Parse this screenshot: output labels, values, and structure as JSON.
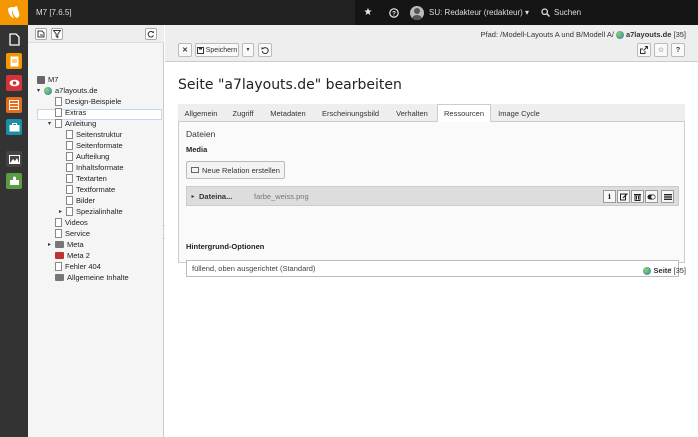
{
  "topbar": {
    "site_name": "M7 [7.6.5]",
    "user_label": "SU: Redakteur (redakteur) ▾",
    "search_label": "Suchen"
  },
  "modules": [
    {
      "name": "page-module",
      "color": "#3a3a3a"
    },
    {
      "name": "list-module",
      "color": "#f49700"
    },
    {
      "name": "view-module",
      "color": "#d3333b"
    },
    {
      "name": "template-module",
      "color": "#e46d1c"
    },
    {
      "name": "info-module",
      "color": "#1b8fa5"
    },
    {
      "name": "filelist-module",
      "color": "#444"
    },
    {
      "name": "extension-module",
      "color": "#5b9b46"
    }
  ],
  "tree": {
    "root": "M7",
    "nodes": [
      {
        "label": "a7layouts.de",
        "type": "globe",
        "indent": 0,
        "arrow": "▾"
      },
      {
        "label": "Design-Beispiele",
        "type": "page",
        "indent": 1,
        "arrow": ""
      },
      {
        "label": "Extras",
        "type": "page",
        "indent": 1,
        "arrow": ""
      },
      {
        "label": "Anleitung",
        "type": "page",
        "indent": 1,
        "arrow": "▾"
      },
      {
        "label": "Seitenstruktur",
        "type": "page",
        "indent": 2,
        "arrow": ""
      },
      {
        "label": "Seitenformate",
        "type": "page",
        "indent": 2,
        "arrow": ""
      },
      {
        "label": "Aufteilung",
        "type": "page",
        "indent": 2,
        "arrow": ""
      },
      {
        "label": "Inhaltsformate",
        "type": "page",
        "indent": 2,
        "arrow": ""
      },
      {
        "label": "Textarten",
        "type": "page",
        "indent": 2,
        "arrow": ""
      },
      {
        "label": "Textformate",
        "type": "page",
        "indent": 2,
        "arrow": ""
      },
      {
        "label": "Bilder",
        "type": "page",
        "indent": 2,
        "arrow": ""
      },
      {
        "label": "Spezialinhalte",
        "type": "page",
        "indent": 2,
        "arrow": "▸"
      },
      {
        "label": "Videos",
        "type": "page",
        "indent": 1,
        "arrow": ""
      },
      {
        "label": "Service",
        "type": "page",
        "indent": 1,
        "arrow": ""
      },
      {
        "label": "Meta",
        "type": "folder",
        "indent": 1,
        "arrow": "▸"
      },
      {
        "label": "Meta 2",
        "type": "folder-red",
        "indent": 1,
        "arrow": ""
      },
      {
        "label": "Fehler 404",
        "type": "page",
        "indent": 1,
        "arrow": ""
      },
      {
        "label": "Allgemeine Inhalte",
        "type": "folder",
        "indent": 1,
        "arrow": ""
      }
    ]
  },
  "docheader": {
    "path_prefix": "Pfad: /Modell-Layouts A und B/Modell A/",
    "path_page": "a7layouts.de",
    "path_id": "[35]",
    "save_label": "Speichern"
  },
  "main": {
    "title": "Seite \"a7layouts.de\" bearbeiten",
    "tabs": [
      "Allgemein",
      "Zugriff",
      "Metadaten",
      "Erscheinungsbild",
      "Verhalten",
      "Ressourcen",
      "Image Cycle"
    ],
    "active_tab": "Ressourcen",
    "section_title": "Dateien",
    "media_label": "Media",
    "new_relation_label": "Neue Relation erstellen",
    "file_name_label": "Dateina...",
    "file_value": "farbe_weiss.png",
    "bg_options_label": "Hintergrund-Optionen",
    "bg_select_value": "füllend, oben ausgerichtet (Standard)",
    "footer_label": "Seite",
    "footer_id": "[35]"
  }
}
